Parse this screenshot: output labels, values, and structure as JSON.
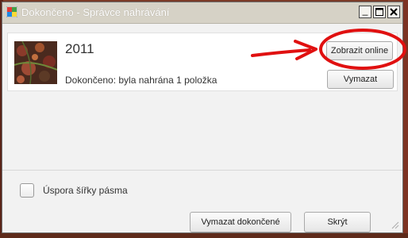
{
  "window": {
    "title": "Dokončeno - Správce nahrávání",
    "minimize_label": "_",
    "maximize_icon": "maximize-icon",
    "close_icon": "close-icon"
  },
  "item": {
    "title": "2011",
    "status": "Dokončeno: byla nahrána 1 položka",
    "view_online_label": "Zobrazit online",
    "delete_label": "Vymazat"
  },
  "footer": {
    "bandwidth_label": "Úspora šířky pásma",
    "bandwidth_checked": false,
    "clear_completed_label": "Vymazat dokončené",
    "hide_label": "Skrýt"
  },
  "annotation": {
    "color": "#e01010"
  }
}
